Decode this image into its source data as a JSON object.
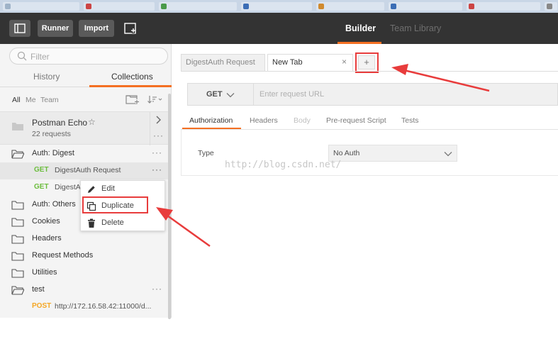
{
  "header": {
    "sidebar_toggle_icon": "sidebar-toggle-icon",
    "runner_label": "Runner",
    "import_label": "Import",
    "new_window_icon": "new-window-icon",
    "tabs": [
      {
        "label": "Builder",
        "active": true
      },
      {
        "label": "Team Library",
        "active": false
      }
    ]
  },
  "sidebar": {
    "filter_placeholder": "Filter",
    "tabs": [
      {
        "label": "History",
        "active": false
      },
      {
        "label": "Collections",
        "active": true
      }
    ],
    "scope_filters": [
      "All",
      "Me",
      "Team"
    ],
    "pinned_collection": {
      "name": "Postman Echo",
      "count": "22 requests"
    },
    "items": [
      {
        "type": "folder",
        "label": "Auth: Digest",
        "open": true
      },
      {
        "type": "request",
        "method": "GET",
        "label": "DigestAuth Request",
        "selected": true
      },
      {
        "type": "request",
        "method": "GET",
        "label": "DigestA"
      },
      {
        "type": "folder",
        "label": "Auth: Others"
      },
      {
        "type": "folder",
        "label": "Cookies"
      },
      {
        "type": "folder",
        "label": "Headers"
      },
      {
        "type": "folder",
        "label": "Request Methods"
      },
      {
        "type": "folder",
        "label": "Utilities"
      },
      {
        "type": "folder",
        "label": "test",
        "open": true
      },
      {
        "type": "request",
        "method": "POST",
        "label": "http://172.16.58.42:11000/d..."
      }
    ],
    "context_menu": [
      {
        "label": "Edit",
        "icon": "pencil-icon"
      },
      {
        "label": "Duplicate",
        "icon": "duplicate-icon",
        "highlighted": true
      },
      {
        "label": "Delete",
        "icon": "trash-icon"
      }
    ]
  },
  "main": {
    "tabs": [
      {
        "label": "DigestAuth Request",
        "active": false
      },
      {
        "label": "New Tab",
        "active": true,
        "close": "×"
      }
    ],
    "add_tab_label": "+",
    "request": {
      "method": "GET",
      "url_placeholder": "Enter request URL"
    },
    "request_tabs": [
      {
        "label": "Authorization",
        "active": true
      },
      {
        "label": "Headers",
        "active": false
      },
      {
        "label": "Body",
        "active": false,
        "disabled": true
      },
      {
        "label": "Pre-request Script",
        "active": false
      },
      {
        "label": "Tests",
        "active": false
      }
    ],
    "auth": {
      "type_label": "Type",
      "type_value": "No Auth"
    },
    "watermark": "http://blog.csdn.net/"
  },
  "colors": {
    "accent": "#f47023",
    "annotation": "#e83c3c",
    "get_method": "#6bbd3c",
    "post_method": "#f5a623",
    "header_bg": "#333333"
  }
}
